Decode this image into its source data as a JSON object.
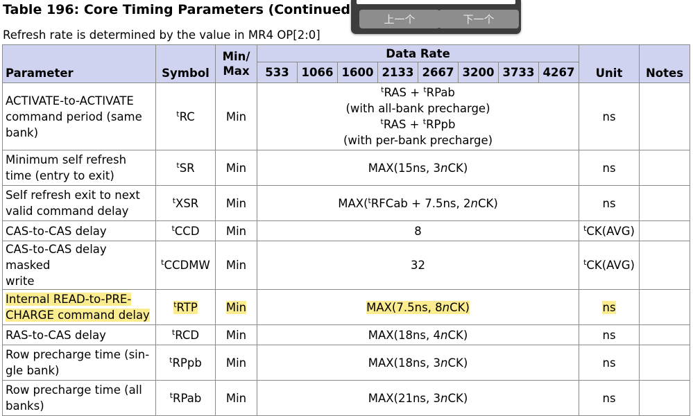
{
  "title": "Table 196: Core Timing Parameters (Continued)",
  "subtitle": "Refresh rate is determined by the value in MR4 OP[2:0]",
  "popup": {
    "prev_label": "上一个",
    "next_label": "下一个"
  },
  "header": {
    "parameter": "Parameter",
    "symbol": "Symbol",
    "minmax_line1": "Min/",
    "minmax_line2": "Max",
    "data_rate": "Data Rate",
    "rates": [
      "533",
      "1066",
      "1600",
      "2133",
      "2667",
      "3200",
      "3733",
      "4267"
    ],
    "unit": "Unit",
    "notes": "Notes"
  },
  "rows": [
    {
      "parameter": [
        "ACTIVATE-to-ACTIVATE",
        "command period (same",
        "bank)"
      ],
      "symbol_sup": "t",
      "symbol": "RC",
      "minmax": "Min",
      "value_lines": [
        {
          "parts": [
            {
              "sup": "t"
            },
            {
              "text": "RAS + "
            },
            {
              "sup": "t"
            },
            {
              "text": "RPab"
            }
          ]
        },
        {
          "parts": [
            {
              "text": "(with all-bank precharge)"
            }
          ]
        },
        {
          "parts": [
            {
              "sup": "t"
            },
            {
              "text": "RAS + "
            },
            {
              "sup": "t"
            },
            {
              "text": "RPpb"
            }
          ]
        },
        {
          "parts": [
            {
              "text": "(with per-bank precharge)"
            }
          ]
        }
      ],
      "unit": "ns",
      "notes": ""
    },
    {
      "parameter": [
        "Minimum self refresh",
        "time (entry to exit)"
      ],
      "symbol_sup": "t",
      "symbol": "SR",
      "minmax": "Min",
      "value_lines": [
        {
          "parts": [
            {
              "text": "MAX(15ns, 3"
            },
            {
              "italic": "n"
            },
            {
              "text": "CK)"
            }
          ]
        }
      ],
      "unit": "ns",
      "notes": ""
    },
    {
      "parameter": [
        "Self refresh exit to next",
        "valid command delay"
      ],
      "symbol_sup": "t",
      "symbol": "XSR",
      "minmax": "Min",
      "value_lines": [
        {
          "parts": [
            {
              "text": "MAX("
            },
            {
              "sup": "t"
            },
            {
              "text": "RFCab + 7.5ns, 2"
            },
            {
              "italic": "n"
            },
            {
              "text": "CK)"
            }
          ]
        }
      ],
      "unit": "ns",
      "notes": ""
    },
    {
      "parameter": [
        "CAS-to-CAS delay"
      ],
      "symbol_sup": "t",
      "symbol": "CCD",
      "minmax": "Min",
      "value_lines": [
        {
          "parts": [
            {
              "text": "8"
            }
          ]
        }
      ],
      "unit_sup": "t",
      "unit": "CK(AVG)",
      "notes": ""
    },
    {
      "parameter": [
        "CAS-to-CAS delay masked",
        "write"
      ],
      "symbol_sup": "t",
      "symbol": "CCDMW",
      "minmax": "Min",
      "value_lines": [
        {
          "parts": [
            {
              "text": "32"
            }
          ]
        }
      ],
      "unit_sup": "t",
      "unit": "CK(AVG)",
      "notes": ""
    },
    {
      "parameter": [
        "Internal READ-to-PRE-",
        "CHARGE command delay"
      ],
      "symbol_sup": "t",
      "symbol": "RTP",
      "minmax": "Min",
      "value_lines": [
        {
          "parts": [
            {
              "text": "MAX(7.5ns, 8"
            },
            {
              "italic": "n"
            },
            {
              "text": "CK)"
            }
          ]
        }
      ],
      "unit": "ns",
      "notes": "",
      "highlight": true
    },
    {
      "parameter": [
        "RAS-to-CAS delay"
      ],
      "symbol_sup": "t",
      "symbol": "RCD",
      "minmax": "Min",
      "value_lines": [
        {
          "parts": [
            {
              "text": "MAX(18ns, 4"
            },
            {
              "italic": "n"
            },
            {
              "text": "CK)"
            }
          ]
        }
      ],
      "unit": "ns",
      "notes": ""
    },
    {
      "parameter": [
        "Row precharge time (sin-",
        "gle bank)"
      ],
      "symbol_sup": "t",
      "symbol": "RPpb",
      "minmax": "Min",
      "value_lines": [
        {
          "parts": [
            {
              "text": "MAX(18ns, 3"
            },
            {
              "italic": "n"
            },
            {
              "text": "CK)"
            }
          ]
        }
      ],
      "unit": "ns",
      "notes": ""
    },
    {
      "parameter": [
        "Row precharge time (all",
        "banks)"
      ],
      "symbol_sup": "t",
      "symbol": "RPab",
      "minmax": "Min",
      "value_lines": [
        {
          "parts": [
            {
              "text": "MAX(21ns, 3"
            },
            {
              "italic": "n"
            },
            {
              "text": "CK)"
            }
          ]
        }
      ],
      "unit": "ns",
      "notes": ""
    }
  ],
  "colors": {
    "header_bg": "#cfd3ef",
    "highlight": "#fbec8f",
    "popup_bg": "#3d3d3d"
  }
}
